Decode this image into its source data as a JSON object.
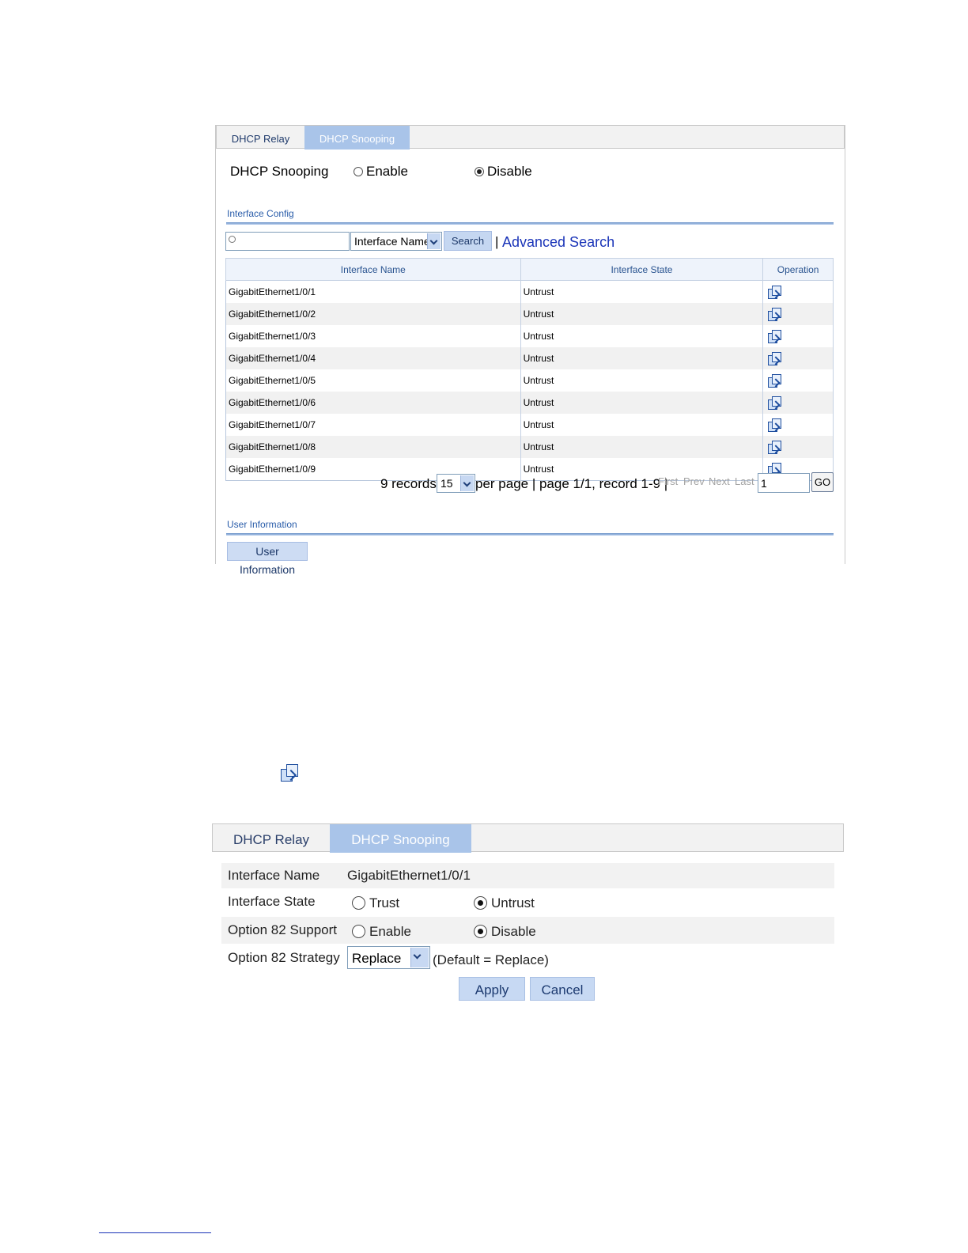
{
  "panel1": {
    "tabs": [
      {
        "label": "DHCP Relay"
      },
      {
        "label": "DHCP Snooping"
      }
    ],
    "dhcp_snooping": {
      "label": "DHCP Snooping",
      "enable_label": "Enable",
      "disable_label": "Disable",
      "selected": "Disable"
    },
    "interface_config": {
      "title": "Interface Config",
      "search": {
        "value": "",
        "field_select": "Interface Name",
        "search_label": "Search",
        "separator": "|",
        "advanced_label": "Advanced Search"
      },
      "table": {
        "columns": [
          "Interface Name",
          "Interface State",
          "Operation"
        ],
        "rows": [
          {
            "name": "GigabitEthernet1/0/1",
            "state": "Untrust",
            "op": "edit-icon"
          },
          {
            "name": "GigabitEthernet1/0/2",
            "state": "Untrust",
            "op": "edit-icon"
          },
          {
            "name": "GigabitEthernet1/0/3",
            "state": "Untrust",
            "op": "edit-icon"
          },
          {
            "name": "GigabitEthernet1/0/4",
            "state": "Untrust",
            "op": "edit-icon"
          },
          {
            "name": "GigabitEthernet1/0/5",
            "state": "Untrust",
            "op": "edit-icon"
          },
          {
            "name": "GigabitEthernet1/0/6",
            "state": "Untrust",
            "op": "edit-icon"
          },
          {
            "name": "GigabitEthernet1/0/7",
            "state": "Untrust",
            "op": "edit-icon"
          },
          {
            "name": "GigabitEthernet1/0/8",
            "state": "Untrust",
            "op": "edit-icon"
          },
          {
            "name": "GigabitEthernet1/0/9",
            "state": "Untrust",
            "op": "edit-icon"
          }
        ]
      },
      "pager": {
        "records": "9 records,",
        "per_page_value": "15",
        "per_page_suffix": "per page | page 1/1, record 1-9 |",
        "first": "First",
        "prev": "Prev",
        "next": "Next",
        "last": "Last",
        "page_input": "1",
        "go": "GO"
      }
    },
    "user_information": {
      "title": "User Information",
      "button": "User Information"
    }
  },
  "standalone_icon": "edit-icon",
  "panel2": {
    "tabs": [
      {
        "label": "DHCP Relay"
      },
      {
        "label": "DHCP Snooping"
      }
    ],
    "interface_name": {
      "label": "Interface Name",
      "value": "GigabitEthernet1/0/1"
    },
    "interface_state": {
      "label": "Interface State",
      "options": [
        "Trust",
        "Untrust"
      ],
      "selected": "Untrust"
    },
    "option82_support": {
      "label": "Option 82 Support",
      "options": [
        "Enable",
        "Disable"
      ],
      "selected": "Disable"
    },
    "option82_strategy": {
      "label": "Option 82 Strategy",
      "value": "Replace",
      "hint": "(Default = Replace)"
    },
    "apply_label": "Apply",
    "cancel_label": "Cancel"
  },
  "colors": {
    "active_tab": "#a9c4e9",
    "link": "#1a34b8",
    "section_title": "#2a5daa"
  }
}
